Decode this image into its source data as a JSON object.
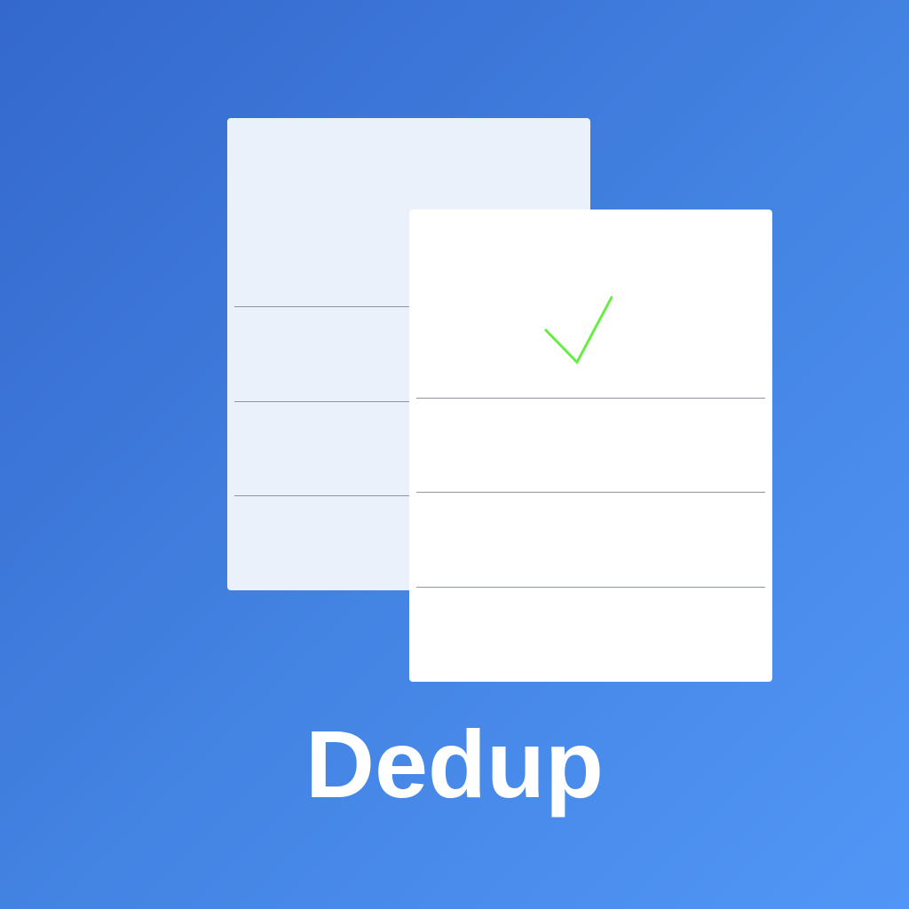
{
  "app": {
    "name": "Dedup"
  },
  "colors": {
    "background_start": "#3468cc",
    "background_end": "#5196f6",
    "back_document": "#ebf1fa",
    "front_document": "#ffffff",
    "rule_line": "#8f959c",
    "checkmark": "#66ee44",
    "title_text": "#ffffff"
  },
  "icons": {
    "back_document": "document-icon",
    "front_document": "document-icon",
    "check": "checkmark-icon"
  }
}
